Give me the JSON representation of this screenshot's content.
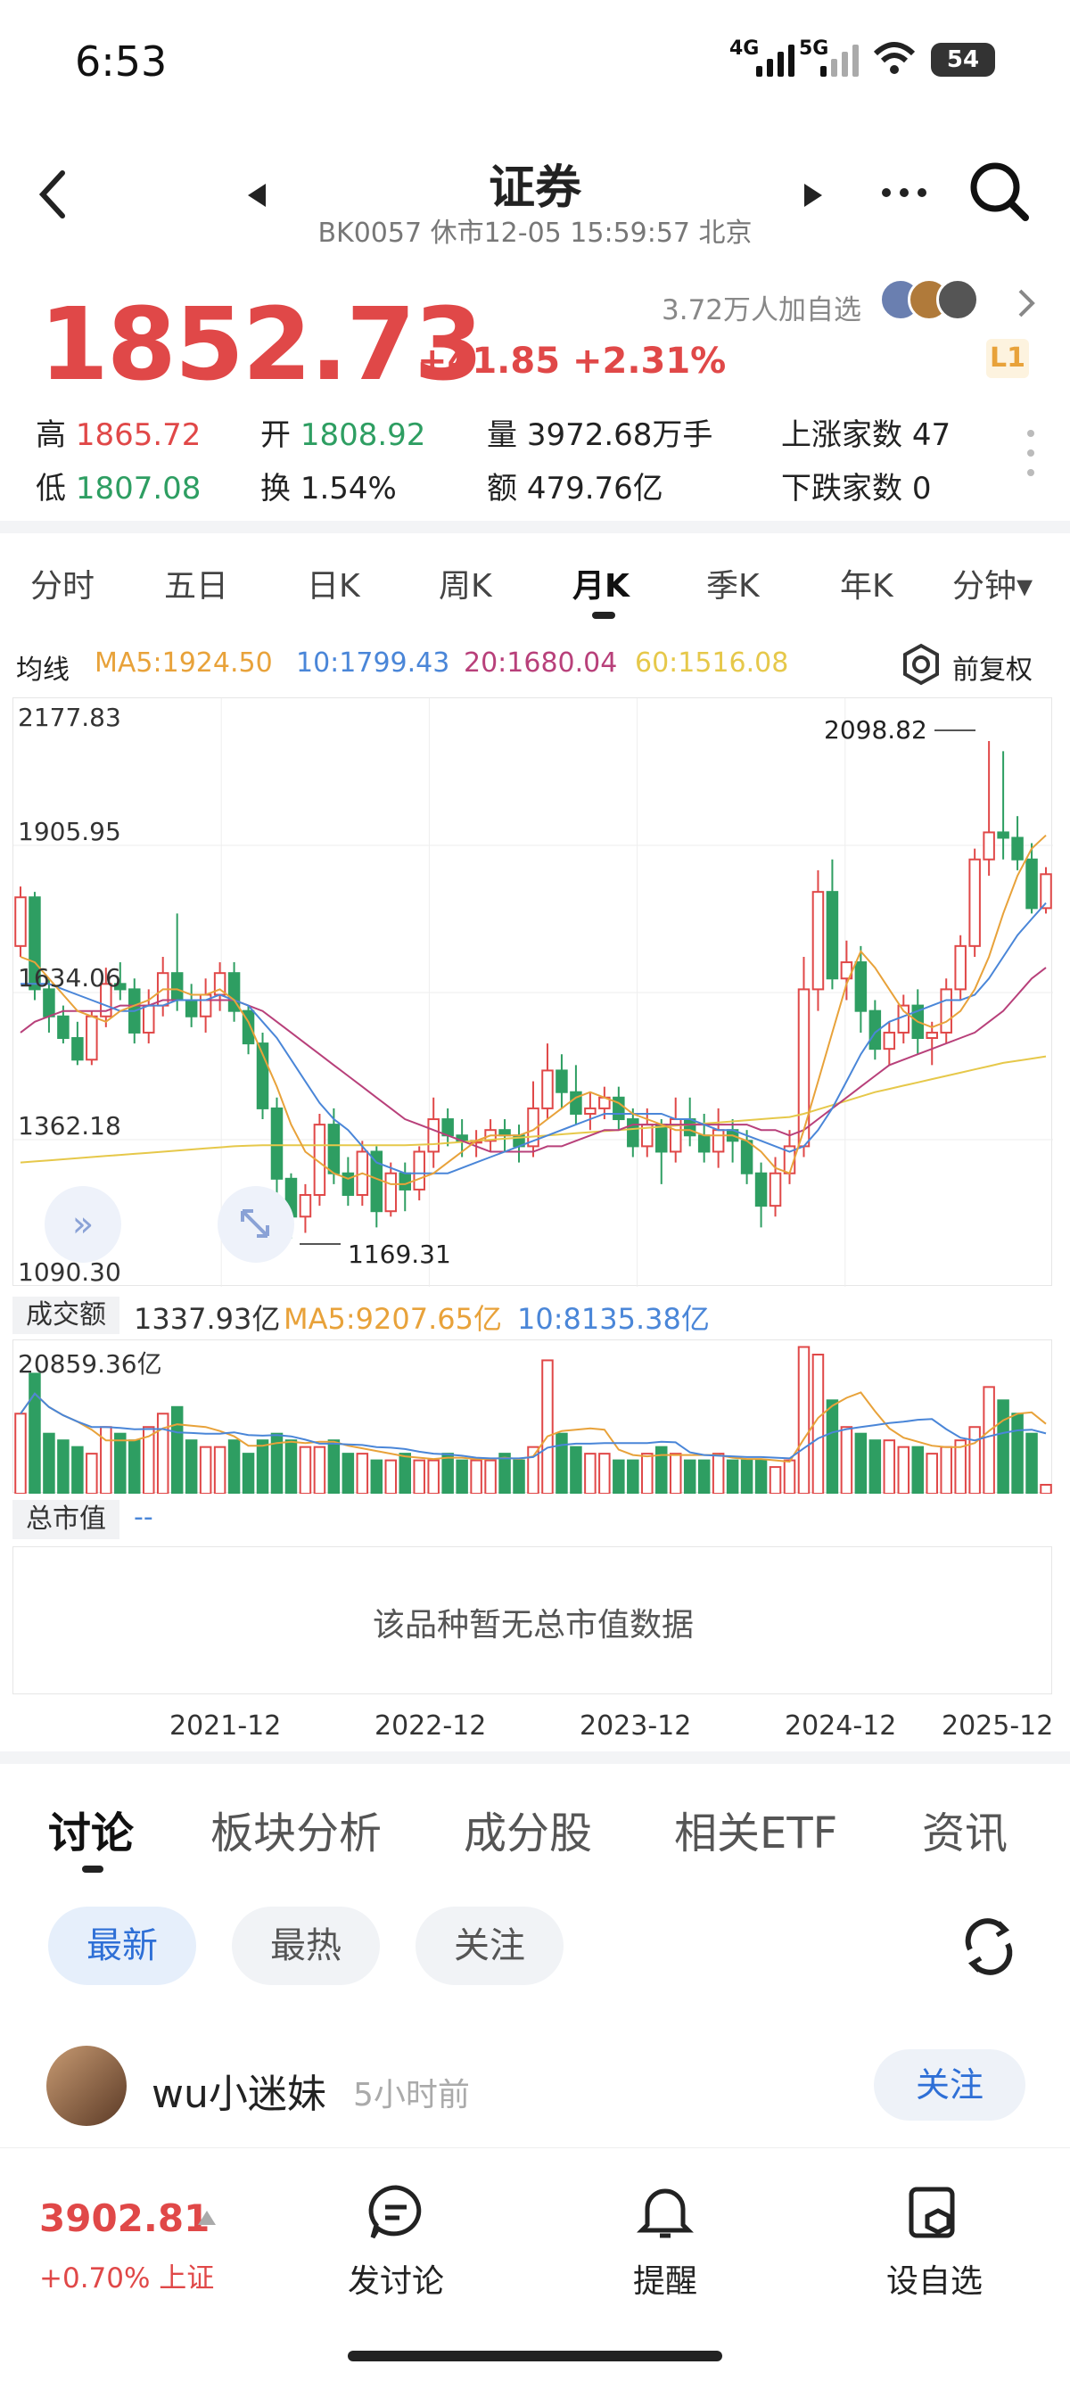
{
  "status_bar": {
    "time": "6:53",
    "net1": "4G",
    "net2": "5G",
    "battery": "54"
  },
  "header": {
    "title": "证券",
    "subtitle": "BK0057 休市12-05 15:59:57 北京",
    "prev_icon": "triangle-left",
    "next_icon": "triangle-right"
  },
  "quote": {
    "price": "1852.73",
    "change": "+41.85 +2.31%",
    "followers": "3.72万人加自选",
    "level": "L1",
    "high_label": "高",
    "high": "1865.72",
    "open_label": "开",
    "open": "1808.92",
    "volume_label": "量",
    "volume": "3972.68万手",
    "up_label": "上涨家数",
    "up": "47",
    "low_label": "低",
    "low": "1807.08",
    "turnover_label": "换",
    "turnover": "1.54%",
    "amount_label": "额",
    "amount": "479.76亿",
    "down_label": "下跌家数",
    "down": "0"
  },
  "period_tabs": [
    "分时",
    "五日",
    "日K",
    "周K",
    "月K",
    "季K",
    "年K",
    "分钟▾"
  ],
  "active_period": "月K",
  "ma_bar": {
    "label": "均线",
    "ma5": "MA5:1924.50",
    "ma10": "10:1799.43",
    "ma20": "20:1680.04",
    "ma60": "60:1516.08",
    "adjust": "前复权"
  },
  "colors": {
    "up": "#e04848",
    "down": "#2e9e62",
    "ma5": "#e8a23a",
    "ma10": "#4a86d8",
    "ma20": "#b8407a",
    "ma60": "#e6c84a",
    "accent": "#2e6fd6"
  },
  "chart_labels": {
    "y_top": "2177.83",
    "y2": "1905.95",
    "y3": "1634.06",
    "y4": "1362.18",
    "y_bottom": "1090.30",
    "max_mark": "2098.82",
    "min_mark": "1169.31"
  },
  "volume_bar": {
    "label": "成交额",
    "value": "1337.93亿",
    "ma5": "MA5:9207.65亿",
    "ma10": "10:8135.38亿",
    "max": "20859.36亿"
  },
  "market_value": {
    "label": "总市值",
    "value": "--",
    "empty_text": "该品种暂无总市值数据"
  },
  "x_labels": [
    "2021-12",
    "2022-12",
    "2023-12",
    "2024-12",
    "2025-12"
  ],
  "discussion_tabs": [
    "讨论",
    "板块分析",
    "成分股",
    "相关ETF",
    "资讯"
  ],
  "filters": [
    "最新",
    "最热",
    "关注"
  ],
  "post": {
    "user": "wu小迷妹",
    "time": "5小时前",
    "follow": "关注"
  },
  "bottom_bar": {
    "index_value": "3902.81",
    "index_change": "+0.70% 上证",
    "items": [
      "发讨论",
      "提醒",
      "设自选"
    ]
  },
  "chart_data": {
    "type": "candlestick",
    "ylim": [
      1090.3,
      2177.83
    ],
    "candles": [
      [
        1720,
        1810,
        1700,
        1830
      ],
      [
        1810,
        1640,
        1620,
        1820
      ],
      [
        1640,
        1590,
        1560,
        1660
      ],
      [
        1590,
        1550,
        1540,
        1610
      ],
      [
        1550,
        1510,
        1500,
        1580
      ],
      [
        1510,
        1590,
        1500,
        1600
      ],
      [
        1590,
        1650,
        1570,
        1680
      ],
      [
        1650,
        1640,
        1620,
        1690
      ],
      [
        1640,
        1560,
        1540,
        1660
      ],
      [
        1560,
        1610,
        1540,
        1640
      ],
      [
        1610,
        1670,
        1590,
        1700
      ],
      [
        1670,
        1620,
        1600,
        1780
      ],
      [
        1620,
        1590,
        1570,
        1650
      ],
      [
        1590,
        1630,
        1560,
        1660
      ],
      [
        1630,
        1670,
        1600,
        1690
      ],
      [
        1670,
        1600,
        1580,
        1690
      ],
      [
        1600,
        1540,
        1520,
        1610
      ],
      [
        1540,
        1420,
        1400,
        1560
      ],
      [
        1420,
        1290,
        1250,
        1440
      ],
      [
        1290,
        1220,
        1180,
        1300
      ],
      [
        1220,
        1260,
        1190,
        1280
      ],
      [
        1260,
        1390,
        1240,
        1410
      ],
      [
        1390,
        1300,
        1280,
        1420
      ],
      [
        1300,
        1260,
        1240,
        1330
      ],
      [
        1260,
        1340,
        1240,
        1360
      ],
      [
        1340,
        1230,
        1200,
        1350
      ],
      [
        1230,
        1300,
        1220,
        1320
      ],
      [
        1300,
        1270,
        1230,
        1320
      ],
      [
        1270,
        1340,
        1250,
        1350
      ],
      [
        1340,
        1400,
        1310,
        1440
      ],
      [
        1400,
        1370,
        1350,
        1420
      ],
      [
        1370,
        1360,
        1330,
        1400
      ],
      [
        1360,
        1360,
        1330,
        1380
      ],
      [
        1360,
        1380,
        1340,
        1400
      ],
      [
        1380,
        1370,
        1340,
        1400
      ],
      [
        1370,
        1350,
        1320,
        1390
      ],
      [
        1350,
        1420,
        1330,
        1470
      ],
      [
        1420,
        1490,
        1400,
        1540
      ],
      [
        1490,
        1450,
        1420,
        1520
      ],
      [
        1450,
        1410,
        1390,
        1500
      ],
      [
        1410,
        1420,
        1380,
        1450
      ],
      [
        1420,
        1440,
        1400,
        1460
      ],
      [
        1440,
        1400,
        1380,
        1460
      ],
      [
        1400,
        1350,
        1330,
        1420
      ],
      [
        1350,
        1390,
        1330,
        1420
      ],
      [
        1390,
        1340,
        1280,
        1400
      ],
      [
        1340,
        1400,
        1320,
        1440
      ],
      [
        1400,
        1370,
        1350,
        1440
      ],
      [
        1370,
        1340,
        1320,
        1410
      ],
      [
        1340,
        1380,
        1310,
        1420
      ],
      [
        1380,
        1360,
        1320,
        1400
      ],
      [
        1360,
        1300,
        1280,
        1380
      ],
      [
        1300,
        1240,
        1200,
        1320
      ],
      [
        1240,
        1300,
        1220,
        1330
      ],
      [
        1300,
        1350,
        1280,
        1380
      ],
      [
        1350,
        1640,
        1330,
        1700
      ],
      [
        1640,
        1820,
        1600,
        1860
      ],
      [
        1820,
        1660,
        1640,
        1880
      ],
      [
        1660,
        1690,
        1620,
        1730
      ],
      [
        1690,
        1600,
        1560,
        1720
      ],
      [
        1600,
        1530,
        1510,
        1620
      ],
      [
        1530,
        1560,
        1500,
        1580
      ],
      [
        1560,
        1610,
        1540,
        1630
      ],
      [
        1610,
        1550,
        1520,
        1640
      ],
      [
        1550,
        1560,
        1500,
        1580
      ],
      [
        1560,
        1640,
        1540,
        1660
      ],
      [
        1640,
        1720,
        1620,
        1740
      ],
      [
        1720,
        1880,
        1700,
        1900
      ],
      [
        1880,
        1930,
        1850,
        2098.82
      ],
      [
        1930,
        1920,
        1880,
        2080
      ],
      [
        1920,
        1880,
        1860,
        1960
      ],
      [
        1880,
        1790,
        1780,
        1910
      ],
      [
        1790,
        1852.73,
        1780,
        1865.72
      ]
    ],
    "ma5": [
      1700,
      1690,
      1660,
      1630,
      1600,
      1590,
      1580,
      1600,
      1610,
      1620,
      1640,
      1640,
      1630,
      1630,
      1640,
      1620,
      1580,
      1520,
      1460,
      1390,
      1340,
      1320,
      1300,
      1290,
      1300,
      1290,
      1280,
      1280,
      1290,
      1300,
      1320,
      1340,
      1360,
      1370,
      1370,
      1370,
      1380,
      1400,
      1420,
      1440,
      1450,
      1440,
      1430,
      1410,
      1400,
      1390,
      1380,
      1380,
      1370,
      1370,
      1370,
      1360,
      1340,
      1310,
      1300,
      1380,
      1470,
      1560,
      1650,
      1710,
      1680,
      1640,
      1600,
      1580,
      1570,
      1580,
      1600,
      1640,
      1700,
      1780,
      1850,
      1900,
      1924.5
    ],
    "ma10": [
      1650,
      1650,
      1650,
      1640,
      1630,
      1620,
      1610,
      1600,
      1600,
      1610,
      1610,
      1620,
      1620,
      1620,
      1630,
      1620,
      1610,
      1580,
      1550,
      1510,
      1470,
      1430,
      1400,
      1380,
      1350,
      1320,
      1310,
      1300,
      1300,
      1300,
      1300,
      1310,
      1320,
      1330,
      1340,
      1350,
      1360,
      1370,
      1380,
      1390,
      1400,
      1410,
      1410,
      1410,
      1410,
      1410,
      1400,
      1400,
      1390,
      1380,
      1380,
      1370,
      1360,
      1350,
      1340,
      1350,
      1380,
      1420,
      1470,
      1520,
      1560,
      1580,
      1590,
      1600,
      1610,
      1620,
      1620,
      1630,
      1660,
      1700,
      1740,
      1770,
      1799.43
    ],
    "ma20": [
      1560,
      1580,
      1590,
      1600,
      1600,
      1600,
      1600,
      1610,
      1610,
      1610,
      1620,
      1620,
      1620,
      1620,
      1620,
      1620,
      1610,
      1600,
      1580,
      1560,
      1540,
      1520,
      1500,
      1480,
      1460,
      1440,
      1420,
      1400,
      1390,
      1380,
      1370,
      1360,
      1350,
      1340,
      1340,
      1340,
      1340,
      1350,
      1350,
      1360,
      1370,
      1380,
      1380,
      1390,
      1390,
      1390,
      1390,
      1390,
      1390,
      1390,
      1390,
      1390,
      1380,
      1380,
      1370,
      1380,
      1400,
      1420,
      1440,
      1460,
      1480,
      1500,
      1510,
      1520,
      1530,
      1540,
      1550,
      1560,
      1580,
      1600,
      1630,
      1660,
      1680.04
    ],
    "ma60": [
      1320,
      1322,
      1324,
      1326,
      1328,
      1330,
      1332,
      1334,
      1336,
      1338,
      1340,
      1342,
      1344,
      1346,
      1348,
      1350,
      1351,
      1352,
      1352,
      1352,
      1352,
      1352,
      1352,
      1352,
      1352,
      1352,
      1352,
      1352,
      1353,
      1354,
      1356,
      1358,
      1360,
      1362,
      1364,
      1366,
      1368,
      1370,
      1372,
      1374,
      1376,
      1378,
      1380,
      1382,
      1384,
      1386,
      1388,
      1390,
      1392,
      1394,
      1396,
      1398,
      1400,
      1402,
      1404,
      1410,
      1418,
      1426,
      1434,
      1442,
      1450,
      1456,
      1462,
      1468,
      1474,
      1480,
      1486,
      1492,
      1498,
      1504,
      1508,
      1512,
      1516.08
    ],
    "volume": [
      12000,
      18000,
      9000,
      8000,
      7000,
      6000,
      10000,
      9000,
      8000,
      10000,
      12000,
      13000,
      8000,
      7000,
      7000,
      8000,
      6000,
      8000,
      9000,
      8000,
      7000,
      7000,
      8000,
      6000,
      6000,
      5000,
      5000,
      6000,
      5000,
      5000,
      6000,
      5000,
      5000,
      5000,
      6000,
      5000,
      7000,
      20000,
      9000,
      7000,
      6000,
      6000,
      5000,
      5000,
      6000,
      7000,
      6000,
      5000,
      5000,
      6000,
      5000,
      5000,
      5000,
      4000,
      5000,
      22000,
      20859,
      14000,
      10000,
      9000,
      8000,
      8000,
      7000,
      7000,
      6000,
      7000,
      8000,
      10000,
      16000,
      14000,
      12000,
      9000,
      1337
    ]
  }
}
